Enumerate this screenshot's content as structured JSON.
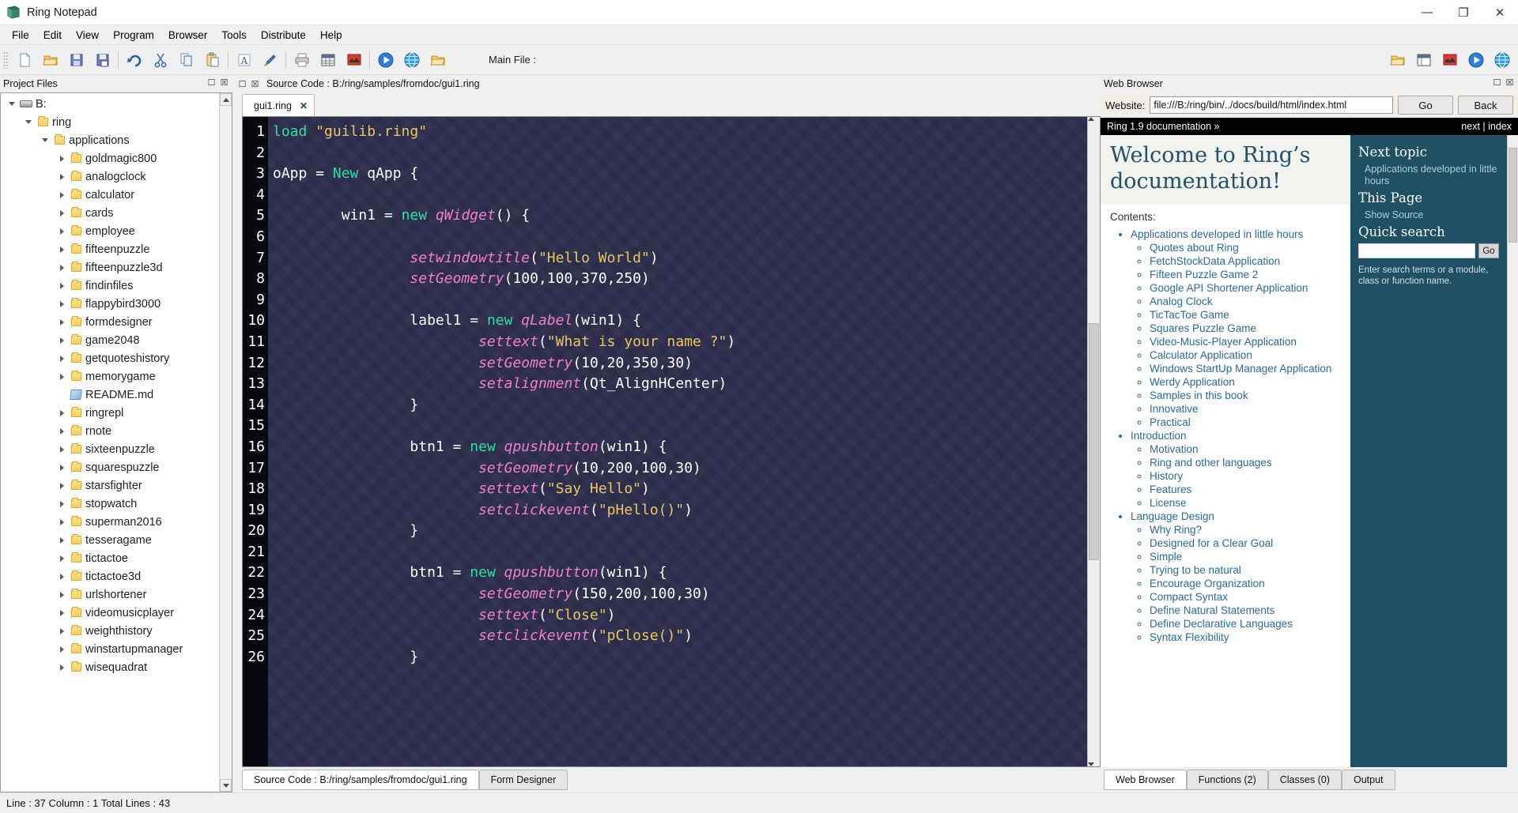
{
  "window": {
    "title": "Ring Notepad",
    "icon": "ring-notepad-icon",
    "minimize": "—",
    "maximize": "❐",
    "close": "✕"
  },
  "menubar": {
    "items": [
      {
        "label": "File"
      },
      {
        "label": "Edit"
      },
      {
        "label": "View"
      },
      {
        "label": "Program"
      },
      {
        "label": "Browser"
      },
      {
        "label": "Tools"
      },
      {
        "label": "Distribute"
      },
      {
        "label": "Help"
      }
    ]
  },
  "toolbar": {
    "main_file_label": "Main File :",
    "buttons": [
      {
        "name": "new-file-icon"
      },
      {
        "name": "open-file-icon"
      },
      {
        "name": "save-icon"
      },
      {
        "name": "save-as-icon"
      },
      {
        "name": "undo-icon"
      },
      {
        "name": "cut-icon"
      },
      {
        "name": "copy-icon"
      },
      {
        "name": "paste-icon"
      },
      {
        "name": "font-icon"
      },
      {
        "name": "highlight-icon"
      },
      {
        "name": "print-icon"
      },
      {
        "name": "table-icon"
      },
      {
        "name": "image-icon"
      },
      {
        "name": "run-icon"
      },
      {
        "name": "web-icon"
      },
      {
        "name": "folder-open-icon"
      }
    ],
    "right_buttons": [
      {
        "name": "open-project-icon"
      },
      {
        "name": "form-designer-icon"
      },
      {
        "name": "image2-icon"
      },
      {
        "name": "run2-icon"
      },
      {
        "name": "globe-icon"
      }
    ]
  },
  "project_files": {
    "header": "Project Files",
    "tree": [
      {
        "label": "B:",
        "depth": 0,
        "icon": "drive-icon",
        "twist": "open"
      },
      {
        "label": "ring",
        "depth": 1,
        "icon": "folder-icon",
        "twist": "open"
      },
      {
        "label": "applications",
        "depth": 2,
        "icon": "folder-icon",
        "twist": "open"
      },
      {
        "label": "goldmagic800",
        "depth": 3,
        "icon": "folder-icon",
        "twist": "closed"
      },
      {
        "label": "analogclock",
        "depth": 3,
        "icon": "folder-icon",
        "twist": "closed"
      },
      {
        "label": "calculator",
        "depth": 3,
        "icon": "folder-icon",
        "twist": "closed"
      },
      {
        "label": "cards",
        "depth": 3,
        "icon": "folder-icon",
        "twist": "closed"
      },
      {
        "label": "employee",
        "depth": 3,
        "icon": "folder-icon",
        "twist": "closed"
      },
      {
        "label": "fifteenpuzzle",
        "depth": 3,
        "icon": "folder-icon",
        "twist": "closed"
      },
      {
        "label": "fifteenpuzzle3d",
        "depth": 3,
        "icon": "folder-icon",
        "twist": "closed"
      },
      {
        "label": "findinfiles",
        "depth": 3,
        "icon": "folder-icon",
        "twist": "closed"
      },
      {
        "label": "flappybird3000",
        "depth": 3,
        "icon": "folder-icon",
        "twist": "closed"
      },
      {
        "label": "formdesigner",
        "depth": 3,
        "icon": "folder-icon",
        "twist": "closed"
      },
      {
        "label": "game2048",
        "depth": 3,
        "icon": "folder-icon",
        "twist": "closed"
      },
      {
        "label": "getquoteshistory",
        "depth": 3,
        "icon": "folder-icon",
        "twist": "closed"
      },
      {
        "label": "memorygame",
        "depth": 3,
        "icon": "folder-icon",
        "twist": "closed"
      },
      {
        "label": "README.md",
        "depth": 3,
        "icon": "markdown-file-icon",
        "twist": "none"
      },
      {
        "label": "ringrepl",
        "depth": 3,
        "icon": "folder-icon",
        "twist": "closed"
      },
      {
        "label": "rnote",
        "depth": 3,
        "icon": "folder-icon",
        "twist": "closed"
      },
      {
        "label": "sixteenpuzzle",
        "depth": 3,
        "icon": "folder-icon",
        "twist": "closed"
      },
      {
        "label": "squarespuzzle",
        "depth": 3,
        "icon": "folder-icon",
        "twist": "closed"
      },
      {
        "label": "starsfighter",
        "depth": 3,
        "icon": "folder-icon",
        "twist": "closed"
      },
      {
        "label": "stopwatch",
        "depth": 3,
        "icon": "folder-icon",
        "twist": "closed"
      },
      {
        "label": "superman2016",
        "depth": 3,
        "icon": "folder-icon",
        "twist": "closed"
      },
      {
        "label": "tesseragame",
        "depth": 3,
        "icon": "folder-icon",
        "twist": "closed"
      },
      {
        "label": "tictactoe",
        "depth": 3,
        "icon": "folder-icon",
        "twist": "closed"
      },
      {
        "label": "tictactoe3d",
        "depth": 3,
        "icon": "folder-icon",
        "twist": "closed"
      },
      {
        "label": "urlshortener",
        "depth": 3,
        "icon": "folder-icon",
        "twist": "closed"
      },
      {
        "label": "videomusicplayer",
        "depth": 3,
        "icon": "folder-icon",
        "twist": "closed"
      },
      {
        "label": "weighthistory",
        "depth": 3,
        "icon": "folder-icon",
        "twist": "closed"
      },
      {
        "label": "winstartupmanager",
        "depth": 3,
        "icon": "folder-icon",
        "twist": "closed"
      },
      {
        "label": "wisequadrat",
        "depth": 3,
        "icon": "folder-icon",
        "twist": "closed"
      }
    ]
  },
  "source_pane": {
    "header": "Source Code : B:/ring/samples/fromdoc/gui1.ring",
    "tab": {
      "label": "gui1.ring",
      "close": "✕"
    },
    "bottom_tabs": [
      {
        "label": "Source Code : B:/ring/samples/fromdoc/gui1.ring",
        "active": true
      },
      {
        "label": "Form Designer",
        "active": false
      }
    ],
    "code_lines": [
      {
        "n": 1,
        "tokens": [
          {
            "t": "load ",
            "c": "kw"
          },
          {
            "t": "\"guilib.ring\"",
            "c": "str"
          }
        ]
      },
      {
        "n": 2,
        "tokens": []
      },
      {
        "n": 3,
        "tokens": [
          {
            "t": "oApp ",
            "c": "id"
          },
          {
            "t": "= ",
            "c": "punct"
          },
          {
            "t": "New ",
            "c": "kw"
          },
          {
            "t": "qApp {",
            "c": "id"
          }
        ]
      },
      {
        "n": 4,
        "tokens": []
      },
      {
        "n": 5,
        "tokens": [
          {
            "t": "        win1 ",
            "c": "id"
          },
          {
            "t": "= ",
            "c": "punct"
          },
          {
            "t": "new ",
            "c": "kw"
          },
          {
            "t": "qWidget",
            "c": "mth"
          },
          {
            "t": "() {",
            "c": "punct"
          }
        ]
      },
      {
        "n": 6,
        "tokens": []
      },
      {
        "n": 7,
        "tokens": [
          {
            "t": "                ",
            "c": "punct"
          },
          {
            "t": "setwindowtitle",
            "c": "mth"
          },
          {
            "t": "(",
            "c": "punct"
          },
          {
            "t": "\"Hello World\"",
            "c": "str"
          },
          {
            "t": ")",
            "c": "punct"
          }
        ]
      },
      {
        "n": 8,
        "tokens": [
          {
            "t": "                ",
            "c": "punct"
          },
          {
            "t": "setGeometry",
            "c": "mth"
          },
          {
            "t": "(100,100,370,250)",
            "c": "punct"
          }
        ]
      },
      {
        "n": 9,
        "tokens": []
      },
      {
        "n": 10,
        "tokens": [
          {
            "t": "                label1 ",
            "c": "id"
          },
          {
            "t": "= ",
            "c": "punct"
          },
          {
            "t": "new ",
            "c": "kw"
          },
          {
            "t": "qLabel",
            "c": "mth"
          },
          {
            "t": "(win1) {",
            "c": "punct"
          }
        ]
      },
      {
        "n": 11,
        "tokens": [
          {
            "t": "                        ",
            "c": "punct"
          },
          {
            "t": "settext",
            "c": "mth"
          },
          {
            "t": "(",
            "c": "punct"
          },
          {
            "t": "\"What is your name ?\"",
            "c": "str"
          },
          {
            "t": ")",
            "c": "punct"
          }
        ]
      },
      {
        "n": 12,
        "tokens": [
          {
            "t": "                        ",
            "c": "punct"
          },
          {
            "t": "setGeometry",
            "c": "mth"
          },
          {
            "t": "(10,20,350,30)",
            "c": "punct"
          }
        ]
      },
      {
        "n": 13,
        "tokens": [
          {
            "t": "                        ",
            "c": "punct"
          },
          {
            "t": "setalignment",
            "c": "mth"
          },
          {
            "t": "(Qt_AlignHCenter)",
            "c": "punct"
          }
        ]
      },
      {
        "n": 14,
        "tokens": [
          {
            "t": "                }",
            "c": "punct"
          }
        ]
      },
      {
        "n": 15,
        "tokens": []
      },
      {
        "n": 16,
        "tokens": [
          {
            "t": "                btn1 ",
            "c": "id"
          },
          {
            "t": "= ",
            "c": "punct"
          },
          {
            "t": "new ",
            "c": "kw"
          },
          {
            "t": "qpushbutton",
            "c": "mth"
          },
          {
            "t": "(win1) {",
            "c": "punct"
          }
        ]
      },
      {
        "n": 17,
        "tokens": [
          {
            "t": "                        ",
            "c": "punct"
          },
          {
            "t": "setGeometry",
            "c": "mth"
          },
          {
            "t": "(10,200,100,30)",
            "c": "punct"
          }
        ]
      },
      {
        "n": 18,
        "tokens": [
          {
            "t": "                        ",
            "c": "punct"
          },
          {
            "t": "settext",
            "c": "mth"
          },
          {
            "t": "(",
            "c": "punct"
          },
          {
            "t": "\"Say Hello\"",
            "c": "str"
          },
          {
            "t": ")",
            "c": "punct"
          }
        ]
      },
      {
        "n": 19,
        "tokens": [
          {
            "t": "                        ",
            "c": "punct"
          },
          {
            "t": "setclickevent",
            "c": "mth"
          },
          {
            "t": "(",
            "c": "punct"
          },
          {
            "t": "\"pHello()\"",
            "c": "str"
          },
          {
            "t": ")",
            "c": "punct"
          }
        ]
      },
      {
        "n": 20,
        "tokens": [
          {
            "t": "                }",
            "c": "punct"
          }
        ]
      },
      {
        "n": 21,
        "tokens": []
      },
      {
        "n": 22,
        "tokens": [
          {
            "t": "                btn1 ",
            "c": "id"
          },
          {
            "t": "= ",
            "c": "punct"
          },
          {
            "t": "new ",
            "c": "kw"
          },
          {
            "t": "qpushbutton",
            "c": "mth"
          },
          {
            "t": "(win1) {",
            "c": "punct"
          }
        ]
      },
      {
        "n": 23,
        "tokens": [
          {
            "t": "                        ",
            "c": "punct"
          },
          {
            "t": "setGeometry",
            "c": "mth"
          },
          {
            "t": "(150,200,100,30)",
            "c": "punct"
          }
        ]
      },
      {
        "n": 24,
        "tokens": [
          {
            "t": "                        ",
            "c": "punct"
          },
          {
            "t": "settext",
            "c": "mth"
          },
          {
            "t": "(",
            "c": "punct"
          },
          {
            "t": "\"Close\"",
            "c": "str"
          },
          {
            "t": ")",
            "c": "punct"
          }
        ]
      },
      {
        "n": 25,
        "tokens": [
          {
            "t": "                        ",
            "c": "punct"
          },
          {
            "t": "setclickevent",
            "c": "mth"
          },
          {
            "t": "(",
            "c": "punct"
          },
          {
            "t": "\"pClose()\"",
            "c": "str"
          },
          {
            "t": ")",
            "c": "punct"
          }
        ]
      },
      {
        "n": 26,
        "tokens": [
          {
            "t": "                }",
            "c": "punct"
          }
        ]
      }
    ]
  },
  "web_pane": {
    "header": "Web Browser",
    "website_label": "Website:",
    "url": "file:///B:/ring/bin/../docs/build/html/index.html",
    "go_label": "Go",
    "back_label": "Back",
    "doc": {
      "breadcrumb": "Ring 1.9 documentation »",
      "nav_right": "next | index",
      "title": "Welcome to Ring’s documentation!",
      "contents_label": "Contents:",
      "sections": [
        {
          "label": "Applications developed in little hours",
          "children": [
            "Quotes about Ring",
            "FetchStockData Application",
            "Fifteen Puzzle Game 2",
            "Google API Shortener Application",
            "Analog Clock",
            "TicTacToe Game",
            "Squares Puzzle Game",
            "Video-Music-Player Application",
            "Calculator Application",
            "Windows StartUp Manager Application",
            "Werdy Application",
            "Samples in this book",
            "Innovative",
            "Practical"
          ]
        },
        {
          "label": "Introduction",
          "children": [
            "Motivation",
            "Ring and other languages",
            "History",
            "Features",
            "License"
          ]
        },
        {
          "label": "Language Design",
          "children": [
            "Why Ring?",
            "Designed for a Clear Goal",
            "Simple",
            "Trying to be natural",
            "Encourage Organization",
            "Compact Syntax",
            "Define Natural Statements",
            "Define Declarative Languages",
            "Syntax Flexibility"
          ]
        }
      ],
      "sidebar": {
        "next_topic_title": "Next topic",
        "next_topic_link": "Applications developed in little hours",
        "this_page_title": "This Page",
        "this_page_link": "Show Source",
        "quick_search_title": "Quick search",
        "search_value": "",
        "search_go": "Go",
        "search_hint": "Enter search terms or a module, class or function name."
      }
    },
    "bottom_tabs": [
      {
        "label": "Web Browser",
        "active": true
      },
      {
        "label": "Functions (2)",
        "active": false
      },
      {
        "label": "Classes (0)",
        "active": false
      },
      {
        "label": "Output",
        "active": false
      }
    ]
  },
  "statusbar": {
    "text": "Line : 37 Column : 1 Total Lines : 43"
  },
  "colors": {
    "accent_teal": "#205064",
    "link_blue": "#2b6a9c",
    "editor_bg": "#2b2b4a",
    "gutter_bg": "#080810",
    "string": "#e7c765",
    "keyword": "#2de0a5",
    "method": "#f07fd0"
  }
}
